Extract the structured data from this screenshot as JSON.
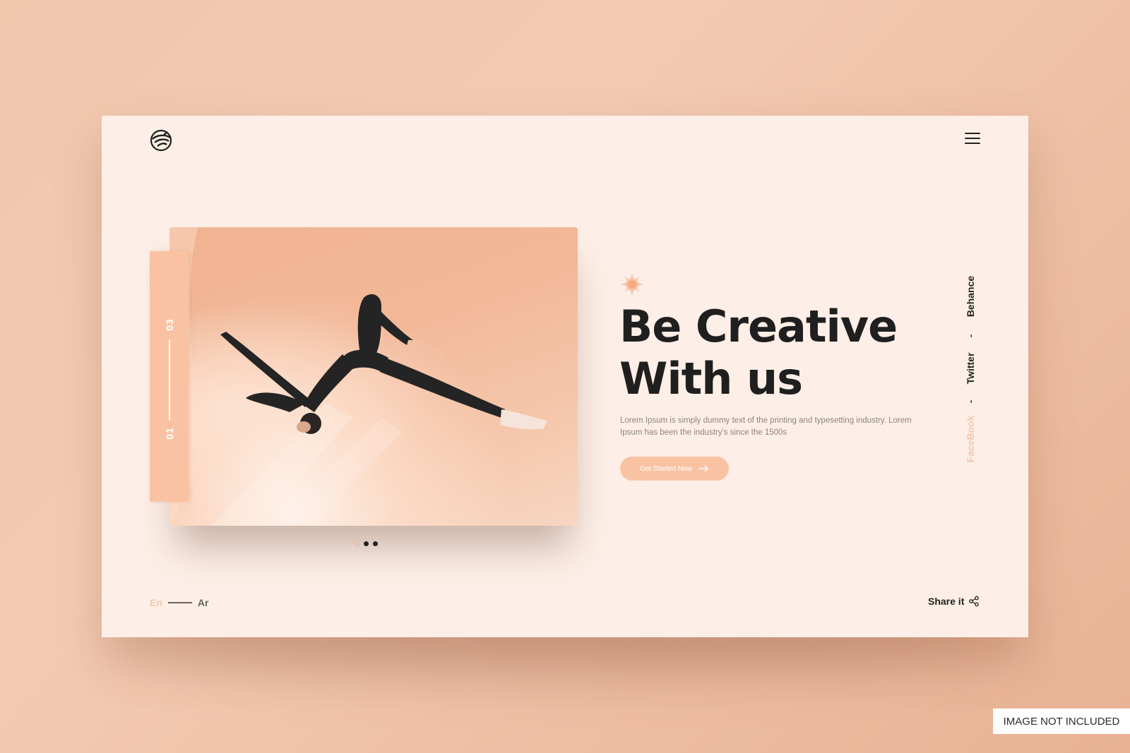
{
  "colors": {
    "accent": "#f9c3a3",
    "accent_light": "#f5c8ae",
    "text_dark": "#1f1f1f",
    "card_bg": "#fdefe7",
    "photo_bg": "#f2b898"
  },
  "header": {
    "logo_icon": "swirl-logo-icon",
    "menu_icon": "hamburger-menu-icon"
  },
  "slider": {
    "counter_top": "03",
    "counter_bottom": "01",
    "dots": [
      {
        "active": false
      },
      {
        "active": true
      },
      {
        "active": true
      }
    ]
  },
  "hero": {
    "decor_icon": "sun-icon",
    "headline_line1": "Be Creative",
    "headline_line2": "With us",
    "description": "Lorem Ipsum is simply dummy text of the printing and typesetting industry. Lorem Ipsum has been the industry's since the 1500s",
    "cta_label": "Get Started Now",
    "cta_icon": "arrow-right-icon"
  },
  "social": {
    "items": [
      "Behance",
      "Twitter",
      "FaceBook"
    ],
    "separator": "-"
  },
  "footer": {
    "lang_en": "En",
    "lang_ar": "Ar",
    "share_label": "Share it",
    "share_icon": "share-icon"
  },
  "overlay": {
    "notice": "IMAGE NOT INCLUDED"
  }
}
